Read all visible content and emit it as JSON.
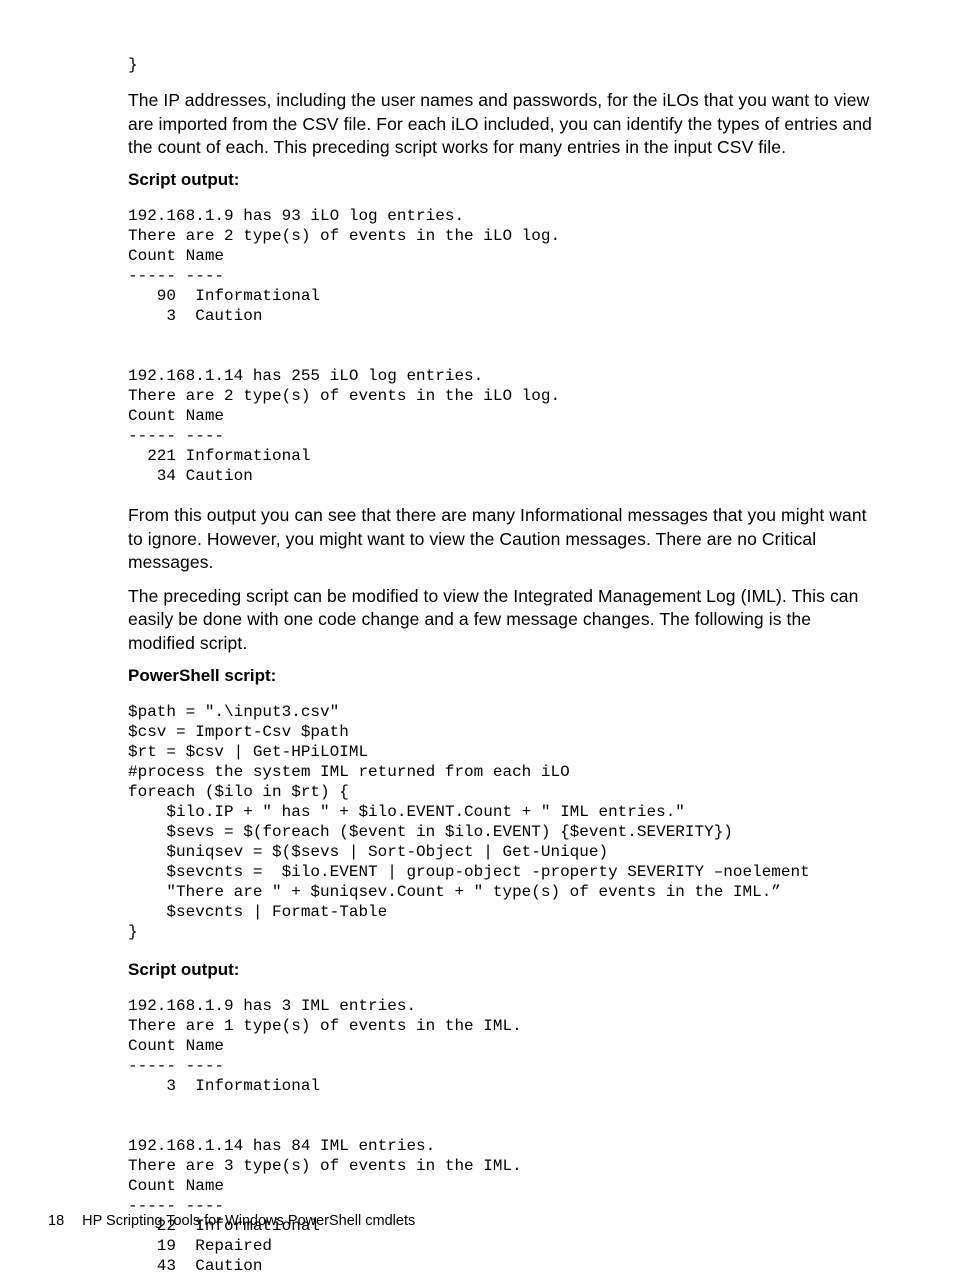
{
  "closingBrace": "}",
  "para1": "The IP addresses, including the user names and passwords, for the iLOs that you want to view are imported from the CSV file. For each iLO included, you can identify the types of entries and the count of each. This preceding script works for many entries in the input CSV file.",
  "label_scriptOutput1": "Script output:",
  "output1": "192.168.1.9 has 93 iLO log entries.\nThere are 2 type(s) of events in the iLO log.\nCount Name\n----- ----\n   90  Informational\n    3  Caution\n\n\n192.168.1.14 has 255 iLO log entries.\nThere are 2 type(s) of events in the iLO log.\nCount Name\n----- ----\n  221 Informational\n   34 Caution",
  "para2": "From this output you can see that there are many Informational messages that you might want to ignore. However, you might want to view the Caution messages. There are no Critical messages.",
  "para3": "The preceding script can be modified to view the Integrated Management Log (IML). This can easily be done with one code change and a few message changes. The following is the modified script.",
  "label_psScript": "PowerShell script:",
  "psScript": "$path = \".\\input3.csv\"\n$csv = Import-Csv $path\n$rt = $csv | Get-HPiLOIML\n#process the system IML returned from each iLO\nforeach ($ilo in $rt) {\n    $ilo.IP + \" has \" + $ilo.EVENT.Count + \" IML entries.\"\n    $sevs = $(foreach ($event in $ilo.EVENT) {$event.SEVERITY})\n    $uniqsev = $($sevs | Sort-Object | Get-Unique)\n    $sevcnts =  $ilo.EVENT | group-object -property SEVERITY –noelement\n    \"There are \" + $uniqsev.Count + \" type(s) of events in the IML.”\n    $sevcnts | Format-Table\n}",
  "label_scriptOutput2": "Script output:",
  "output2": "192.168.1.9 has 3 IML entries.\nThere are 1 type(s) of events in the IML.\nCount Name\n----- ----\n    3  Informational\n\n\n192.168.1.14 has 84 IML entries.\nThere are 3 type(s) of events in the IML.\nCount Name\n----- ----\n   22  Informational\n   19  Repaired\n   43  Caution",
  "footer_page": "18",
  "footer_text": "HP Scripting Tools for Windows PowerShell cmdlets"
}
